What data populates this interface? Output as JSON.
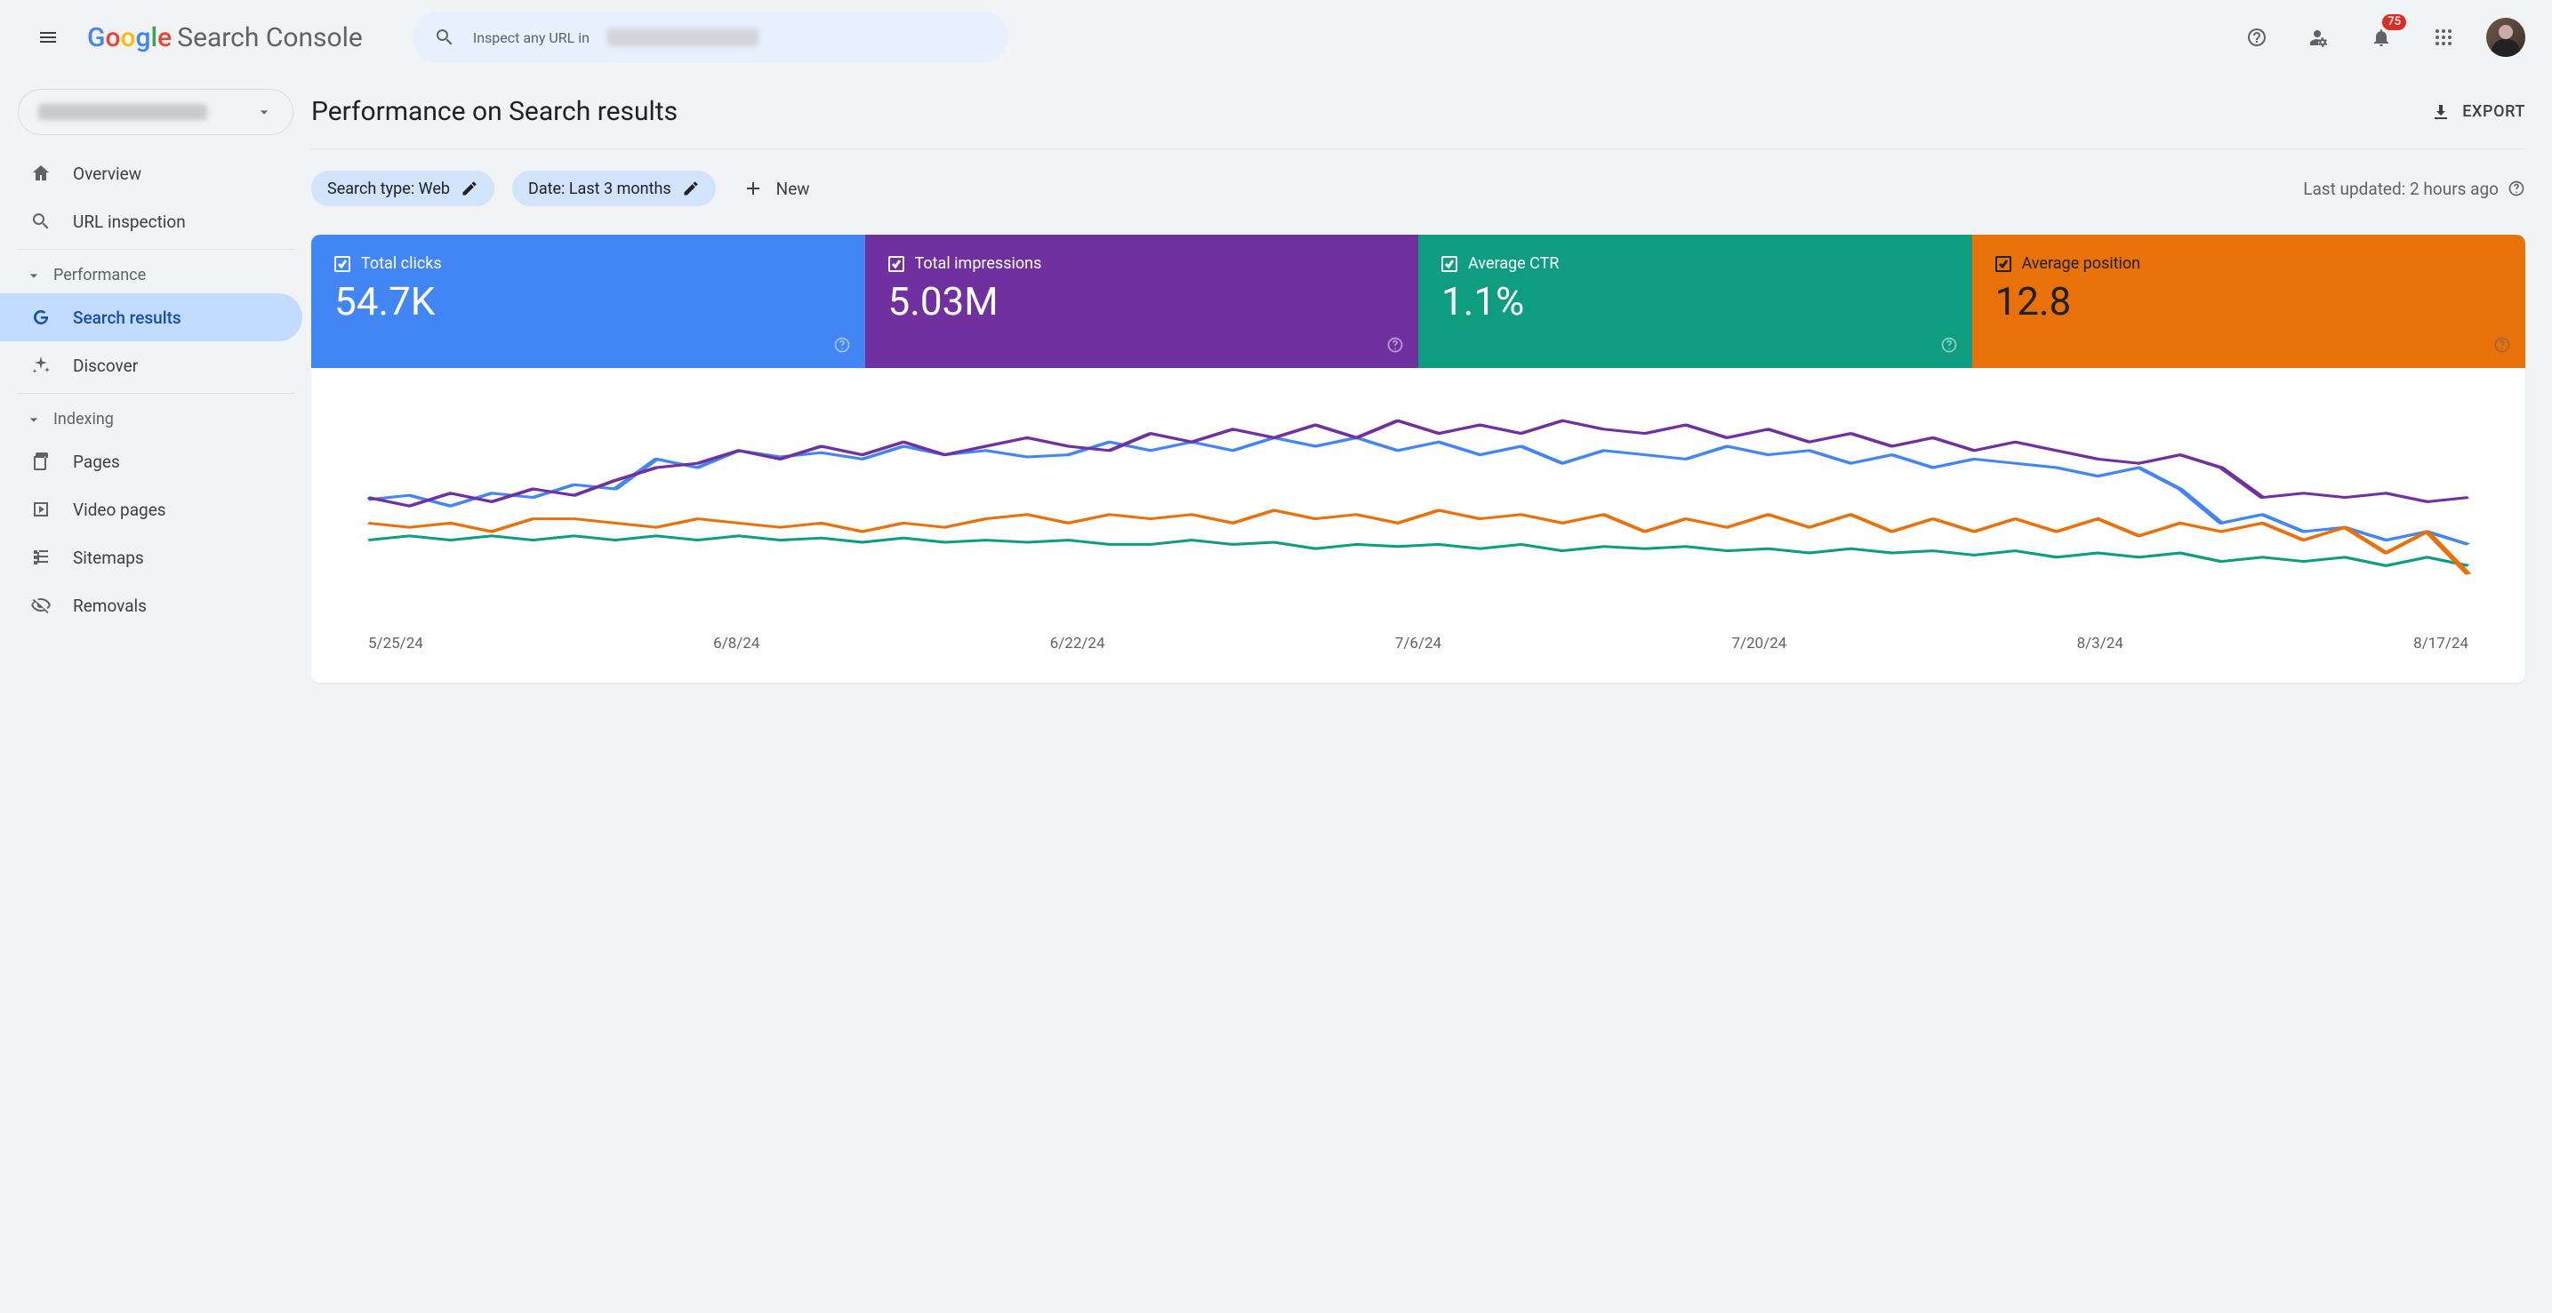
{
  "brand": {
    "name": "Google",
    "product": "Search Console"
  },
  "search": {
    "placeholder_prefix": "Inspect any URL in "
  },
  "notifications": {
    "count": "75"
  },
  "sidebar": {
    "items": [
      {
        "id": "overview",
        "label": "Overview",
        "icon": "home"
      },
      {
        "id": "url-inspection",
        "label": "URL inspection",
        "icon": "search"
      }
    ],
    "sections": [
      {
        "id": "performance",
        "label": "Performance",
        "items": [
          {
            "id": "search-results",
            "label": "Search results",
            "icon": "google",
            "active": true
          },
          {
            "id": "discover",
            "label": "Discover",
            "icon": "sparkle"
          }
        ]
      },
      {
        "id": "indexing",
        "label": "Indexing",
        "items": [
          {
            "id": "pages",
            "label": "Pages",
            "icon": "pages"
          },
          {
            "id": "video",
            "label": "Video pages",
            "icon": "video"
          },
          {
            "id": "sitemaps",
            "label": "Sitemaps",
            "icon": "tree"
          },
          {
            "id": "removals",
            "label": "Removals",
            "icon": "eye-off"
          }
        ]
      }
    ]
  },
  "page": {
    "title": "Performance on Search results",
    "export_label": "EXPORT",
    "filters": {
      "search_type": "Search type: Web",
      "date": "Date: Last 3 months",
      "new_label": "New"
    },
    "last_updated": "Last updated: 2 hours ago"
  },
  "metrics": [
    {
      "id": "clicks",
      "label": "Total clicks",
      "value": "54.7K",
      "color": "#4285F4"
    },
    {
      "id": "impressions",
      "label": "Total impressions",
      "value": "5.03M",
      "color": "#7030A0"
    },
    {
      "id": "ctr",
      "label": "Average CTR",
      "value": "1.1%",
      "color": "#0f9d82"
    },
    {
      "id": "position",
      "label": "Average position",
      "value": "12.8",
      "color": "#e8710a"
    }
  ],
  "chart_data": {
    "type": "line",
    "xlabel": "",
    "ylabel": "",
    "x_ticks": [
      "5/25/24",
      "6/8/24",
      "6/22/24",
      "7/6/24",
      "7/20/24",
      "8/3/24",
      "8/17/24"
    ],
    "note": "y-values are relative (no y-axis shown in source); series normalised 0–100",
    "series": [
      {
        "name": "Total clicks",
        "color": "#4285F4",
        "values": [
          55,
          57,
          52,
          58,
          56,
          62,
          60,
          74,
          70,
          78,
          75,
          77,
          74,
          80,
          76,
          78,
          75,
          76,
          82,
          78,
          82,
          78,
          84,
          80,
          84,
          78,
          82,
          76,
          80,
          72,
          78,
          76,
          74,
          80,
          76,
          78,
          72,
          76,
          70,
          74,
          72,
          70,
          66,
          70,
          60,
          44,
          48,
          40,
          42,
          36,
          40,
          34
        ]
      },
      {
        "name": "Total impressions",
        "color": "#7030A0",
        "values": [
          56,
          52,
          58,
          54,
          60,
          57,
          64,
          70,
          72,
          78,
          74,
          80,
          76,
          82,
          76,
          80,
          84,
          80,
          78,
          86,
          82,
          88,
          84,
          90,
          84,
          92,
          86,
          90,
          86,
          92,
          88,
          86,
          90,
          84,
          88,
          82,
          86,
          80,
          84,
          78,
          82,
          78,
          74,
          72,
          76,
          70,
          56,
          58,
          56,
          58,
          54,
          56
        ]
      },
      {
        "name": "Average CTR",
        "color": "#0f9d82",
        "values": [
          36,
          38,
          36,
          38,
          36,
          38,
          36,
          38,
          36,
          38,
          36,
          37,
          35,
          37,
          35,
          36,
          35,
          36,
          34,
          34,
          36,
          34,
          35,
          32,
          34,
          33,
          34,
          32,
          34,
          31,
          33,
          32,
          33,
          31,
          32,
          30,
          32,
          30,
          31,
          29,
          31,
          28,
          30,
          28,
          30,
          26,
          28,
          26,
          28,
          24,
          28,
          24
        ]
      },
      {
        "name": "Average position",
        "color": "#e8710a",
        "values": [
          44,
          42,
          44,
          40,
          46,
          46,
          44,
          42,
          46,
          44,
          42,
          44,
          40,
          44,
          42,
          46,
          48,
          44,
          48,
          46,
          48,
          44,
          50,
          46,
          48,
          44,
          50,
          46,
          48,
          44,
          48,
          40,
          46,
          42,
          48,
          42,
          48,
          40,
          46,
          40,
          46,
          40,
          46,
          38,
          44,
          40,
          44,
          36,
          42,
          30,
          40,
          20
        ]
      }
    ]
  }
}
